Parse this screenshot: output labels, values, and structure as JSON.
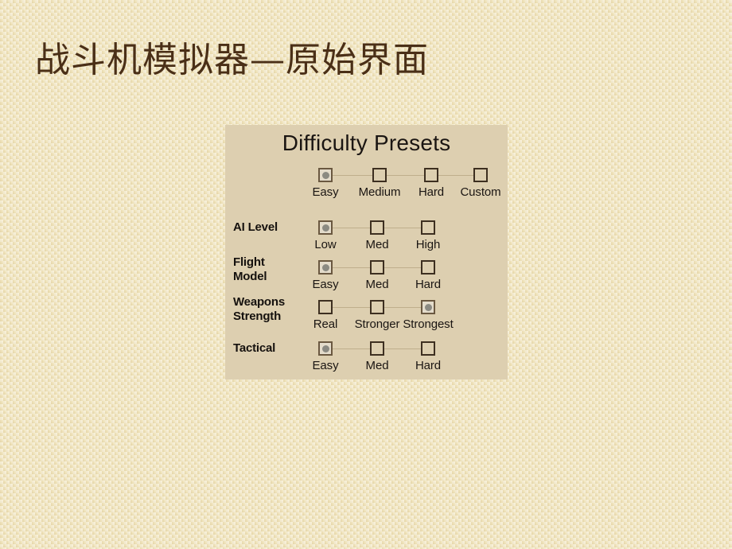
{
  "slide": {
    "title": "战斗机模拟器—原始界面",
    "background_color": "#f2e7c2",
    "title_color": "#4a2f17"
  },
  "dialog": {
    "heading": "Difficulty Presets",
    "panel_color": "#ddcfb0",
    "checkbox_border_color": "#3d2f20",
    "checkbox_dot_color": "#8b8a82",
    "rows": [
      {
        "label": "",
        "options": [
          {
            "label": "Easy",
            "checked": true
          },
          {
            "label": "Medium",
            "checked": false
          },
          {
            "label": "Hard",
            "checked": false
          },
          {
            "label": "Custom",
            "checked": false
          }
        ]
      },
      {
        "label": "AI Level",
        "options": [
          {
            "label": "Low",
            "checked": true
          },
          {
            "label": "Med",
            "checked": false
          },
          {
            "label": "High",
            "checked": false
          }
        ]
      },
      {
        "label": "Flight Model",
        "options": [
          {
            "label": "Easy",
            "checked": true
          },
          {
            "label": "Med",
            "checked": false
          },
          {
            "label": "Hard",
            "checked": false
          }
        ]
      },
      {
        "label": "Weapons Strength",
        "options": [
          {
            "label": "Real",
            "checked": false
          },
          {
            "label": "Stronger",
            "checked": false
          },
          {
            "label": "Strongest",
            "checked": true
          }
        ]
      },
      {
        "label": "Tactical",
        "options": [
          {
            "label": "Easy",
            "checked": true
          },
          {
            "label": "Med",
            "checked": false
          },
          {
            "label": "Hard",
            "checked": false
          }
        ]
      }
    ]
  }
}
